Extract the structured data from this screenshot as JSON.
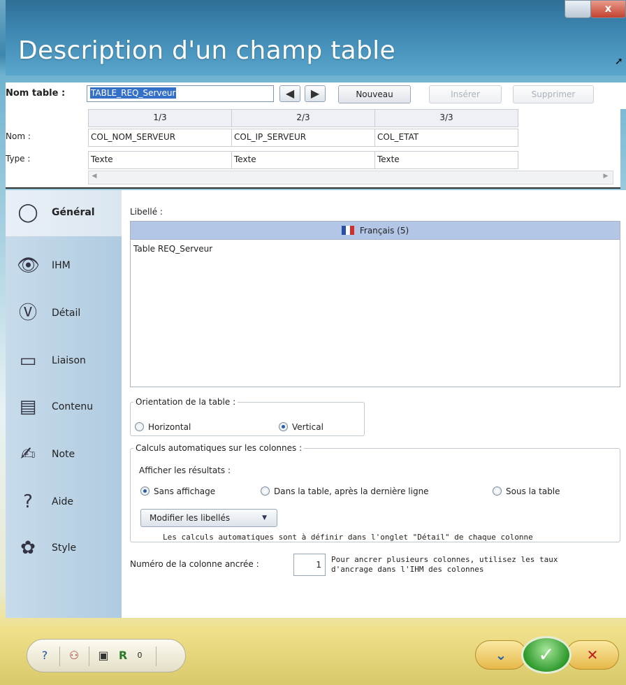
{
  "window": {
    "title": "Description d'un champ table",
    "close_glyph": "x"
  },
  "toolbar": {
    "nom_table_label": "Nom table :",
    "nom_table_value": "TABLE_REQ_Serveur",
    "prev_glyph": "◀",
    "next_glyph": "▶",
    "nouveau": "Nouveau",
    "inserer": "Insérer",
    "supprimer": "Supprimer"
  },
  "grid": {
    "row_labels": {
      "nom": "Nom :",
      "type": "Type :"
    },
    "columns": [
      {
        "header": "1/3",
        "nom": "COL_NOM_SERVEUR",
        "type": "Texte"
      },
      {
        "header": "2/3",
        "nom": "COL_IP_SERVEUR",
        "type": "Texte"
      },
      {
        "header": "3/3",
        "nom": "COL_ETAT",
        "type": "Texte"
      }
    ]
  },
  "sidebar": {
    "items": [
      {
        "label": "Général",
        "icon": "general-icon",
        "active": true
      },
      {
        "label": "IHM",
        "icon": "eye-icon"
      },
      {
        "label": "Détail",
        "icon": "detail-icon"
      },
      {
        "label": "Liaison",
        "icon": "liaison-icon"
      },
      {
        "label": "Contenu",
        "icon": "contenu-icon"
      },
      {
        "label": "Note",
        "icon": "note-icon"
      },
      {
        "label": "Aide",
        "icon": "help-icon"
      },
      {
        "label": "Style",
        "icon": "style-icon"
      }
    ]
  },
  "libelle": {
    "label": "Libellé :",
    "language": "Français (5)",
    "text": "Table REQ_Serveur"
  },
  "orientation": {
    "legend": "Orientation de la table :",
    "options": [
      {
        "label": "Horizontal",
        "selected": false
      },
      {
        "label": "Vertical",
        "selected": true
      }
    ]
  },
  "calculs": {
    "legend": "Calculs automatiques sur les colonnes :",
    "afficher_label": "Afficher les résultats :",
    "options": [
      {
        "label": "Sans affichage",
        "selected": true
      },
      {
        "label": "Dans la table, après la dernière ligne",
        "selected": false
      },
      {
        "label": "Sous la table",
        "selected": false
      }
    ],
    "modifier_button": "Modifier les libellés",
    "note": "Les calculs automatiques sont à définir dans l'onglet \"Détail\" de chaque colonne"
  },
  "ancrage": {
    "label": "Numéro de la colonne ancrée :",
    "value": "1",
    "note_line1": "Pour ancrer plusieurs colonnes, utilisez les taux",
    "note_line2": "d'ancrage dans l'IHM des colonnes"
  },
  "bottombar": {
    "counter": "0",
    "colors": {
      "ok": "#2f9a2c",
      "cancel": "#c01c1c",
      "accent": "#2c62a8"
    }
  }
}
